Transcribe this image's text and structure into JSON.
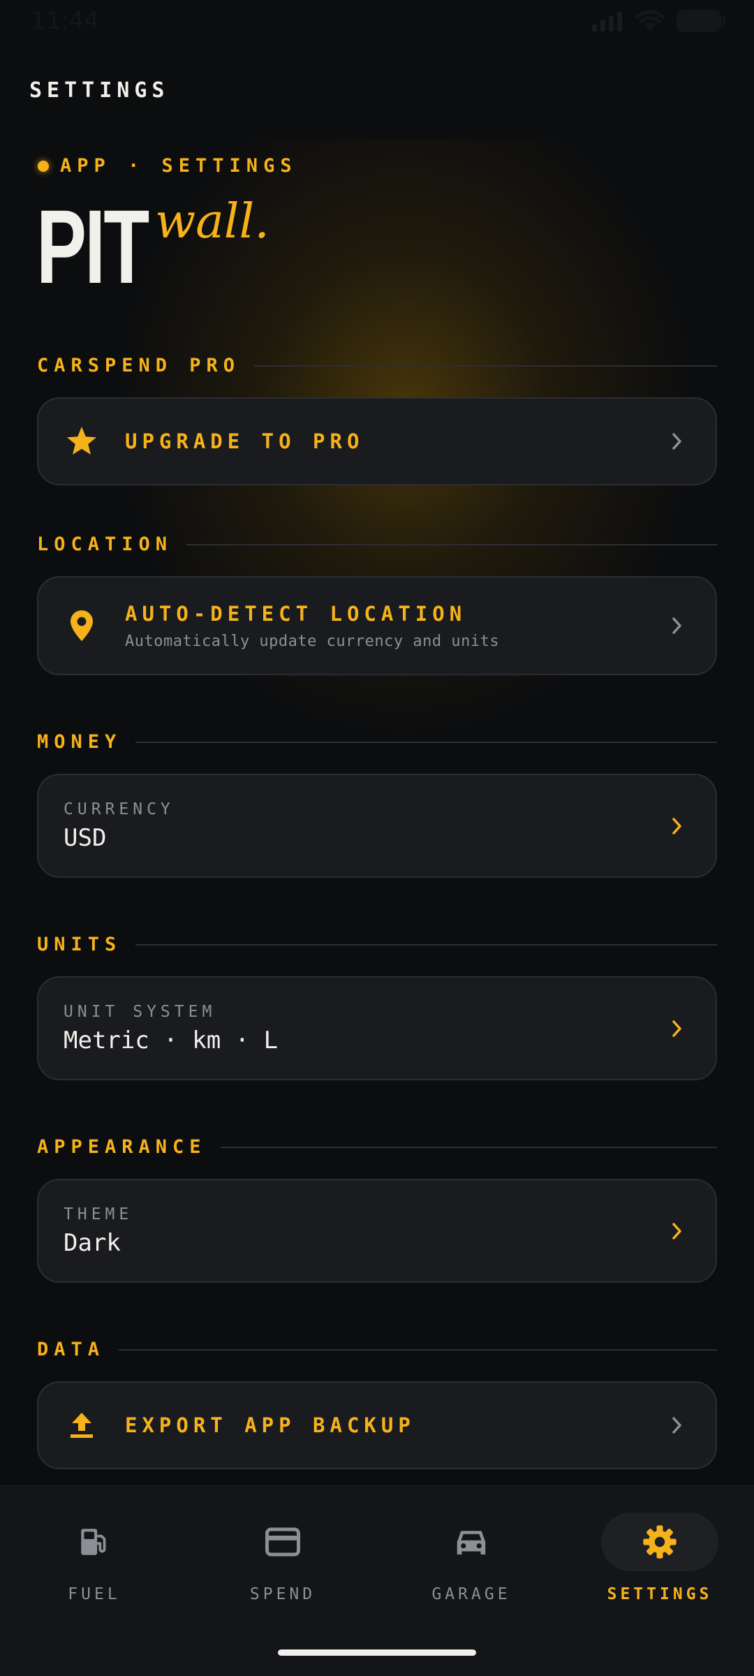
{
  "status": {
    "time": "11:44"
  },
  "header": {
    "title": "SETTINGS"
  },
  "hero": {
    "eyebrow": "APP · SETTINGS",
    "title": "PIT",
    "script": "wall."
  },
  "sections": {
    "pro": {
      "label": "CARSPEND PRO",
      "card": {
        "title": "UPGRADE TO PRO",
        "icon": "star-icon"
      }
    },
    "location": {
      "label": "LOCATION",
      "card": {
        "title": "AUTO-DETECT LOCATION",
        "subtitle": "Automatically update currency and units",
        "icon": "map-pin-icon"
      }
    },
    "money": {
      "label": "MONEY",
      "card": {
        "field_label": "CURRENCY",
        "value": "USD"
      }
    },
    "units": {
      "label": "UNITS",
      "card": {
        "field_label": "UNIT SYSTEM",
        "value": "Metric · km · L"
      }
    },
    "appearance": {
      "label": "APPEARANCE",
      "card": {
        "field_label": "THEME",
        "value": "Dark"
      }
    },
    "data": {
      "label": "DATA",
      "card": {
        "title": "EXPORT APP BACKUP",
        "icon": "upload-icon"
      }
    }
  },
  "tabs": [
    {
      "label": "FUEL",
      "icon": "fuel-pump-icon",
      "active": false
    },
    {
      "label": "SPEND",
      "icon": "credit-card-icon",
      "active": false
    },
    {
      "label": "GARAGE",
      "icon": "car-icon",
      "active": false
    },
    {
      "label": "SETTINGS",
      "icon": "gear-icon",
      "active": true
    }
  ],
  "colors": {
    "background": "#0c0d0f",
    "card": "#1a1b1f",
    "accent": "#f6b21a",
    "text": "#f2f0ea",
    "muted": "#8d8f94"
  }
}
